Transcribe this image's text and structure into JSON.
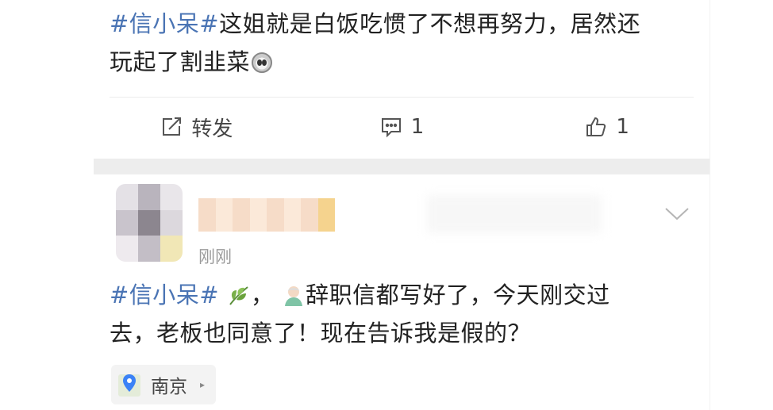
{
  "post1": {
    "hashtag": "#信小呆#",
    "text_line1": "这姐就是白饭吃惯了不想再努力，居然还",
    "text_line2": "玩起了割韭菜",
    "emoji": "face-emoji"
  },
  "actions": {
    "repost_label": "转发",
    "comment_count": "1",
    "like_count": "1"
  },
  "post2": {
    "time": "刚刚",
    "hashtag": "#信小呆#",
    "comma": "，",
    "text_line1_rest": "辞职信都写好了，今天刚交过",
    "text_line2": "去，老板也同意了！现在告诉我是假的？",
    "location": "南京",
    "location_arrow": "▸"
  },
  "colors": {
    "hashtag": "#4a74b4",
    "separator": "#ededed",
    "location_pin": "#3b82f6"
  },
  "icons": [
    "repost-icon",
    "comment-icon",
    "like-icon",
    "chevron-down-icon",
    "location-pin-icon",
    "leaf-icon",
    "avatar-emoji-icon"
  ]
}
